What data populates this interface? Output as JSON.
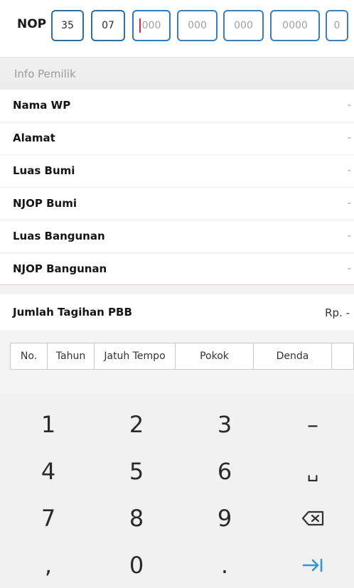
{
  "nop": {
    "label": "NOP",
    "segments": [
      {
        "value": "35",
        "placeholder": ""
      },
      {
        "value": "07",
        "placeholder": ""
      },
      {
        "value": "",
        "placeholder": "000"
      },
      {
        "value": "",
        "placeholder": "000"
      },
      {
        "value": "",
        "placeholder": "000"
      },
      {
        "value": "",
        "placeholder": "0000"
      },
      {
        "value": "",
        "placeholder": "0"
      }
    ]
  },
  "info": {
    "section_title": "Info Pemilik",
    "rows": [
      {
        "label": "Nama WP",
        "value": "-"
      },
      {
        "label": "Alamat",
        "value": "-"
      },
      {
        "label": "Luas Bumi",
        "value": "-"
      },
      {
        "label": "NJOP Bumi",
        "value": "-"
      },
      {
        "label": "Luas Bangunan",
        "value": "-"
      },
      {
        "label": "NJOP Bangunan",
        "value": "-"
      }
    ]
  },
  "tagihan": {
    "label": "Jumlah Tagihan PBB",
    "value": "Rp. -"
  },
  "table": {
    "headers": [
      "No.",
      "Tahun",
      "Jatuh Tempo",
      "Pokok",
      "Denda"
    ]
  },
  "keyboard": {
    "keys": [
      [
        "1",
        "2",
        "3",
        "–"
      ],
      [
        "4",
        "5",
        "6",
        "␣"
      ],
      [
        "7",
        "8",
        "9",
        "backspace-icon"
      ],
      [
        ",",
        "0",
        ".",
        "next-icon"
      ]
    ],
    "accent": "#2b9ad6"
  }
}
